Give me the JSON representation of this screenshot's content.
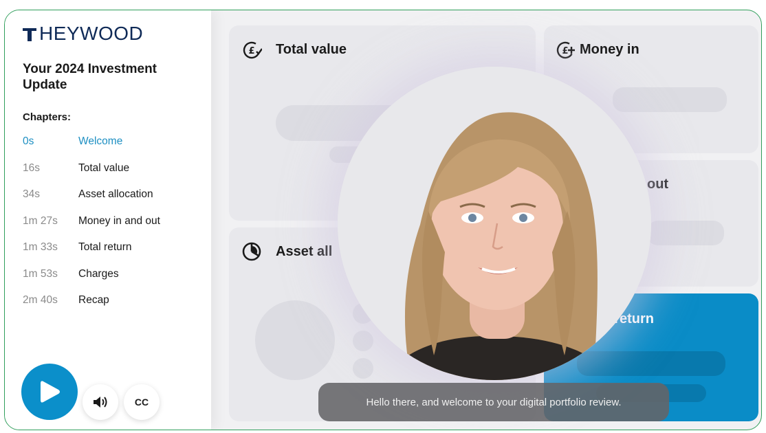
{
  "brand": {
    "logo_text": "HEYWOOD"
  },
  "sidebar": {
    "title": "Your 2024 Investment Update",
    "chapters_heading": "Chapters:",
    "chapters": [
      {
        "time": "0s",
        "label": "Welcome",
        "active": true
      },
      {
        "time": "16s",
        "label": "Total value"
      },
      {
        "time": "34s",
        "label": "Asset allocation"
      },
      {
        "time": "1m 27s",
        "label": "Money in and out"
      },
      {
        "time": "1m 33s",
        "label": "Total return"
      },
      {
        "time": "1m 53s",
        "label": "Charges"
      },
      {
        "time": "2m 40s",
        "label": "Recap"
      }
    ]
  },
  "controls": {
    "play_icon": "play-icon",
    "volume_icon": "volume-icon",
    "cc_label": "CC"
  },
  "cards": {
    "total_value": {
      "title": "Total value",
      "icon": "pound-check-icon"
    },
    "money_in": {
      "title": "Money in",
      "icon": "pound-plus-icon"
    },
    "money_out_partial": {
      "title": "out"
    },
    "asset_allocation": {
      "title": "Asset all",
      "icon": "pie-chart-icon"
    },
    "total_return_partial": {
      "title": "t return"
    }
  },
  "video": {
    "caption": "Hello there, and welcome to your digital portfolio review."
  },
  "colors": {
    "brand_navy": "#0f2a57",
    "accent_blue": "#0b8fca",
    "active_chapter": "#1d8fc2",
    "frame_border": "#2f9e5a"
  }
}
